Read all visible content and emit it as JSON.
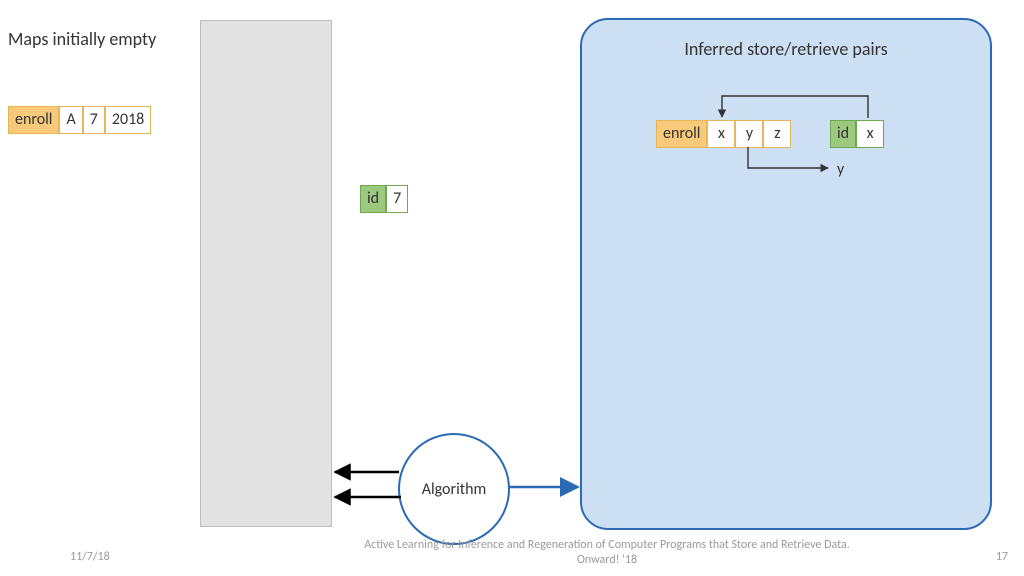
{
  "header": {
    "maps_empty": "Maps initially empty"
  },
  "enroll_example": {
    "label": "enroll",
    "a": "A",
    "b": "7",
    "c": "2018"
  },
  "id_example": {
    "label": "id",
    "value": "7"
  },
  "algorithm": {
    "label": "Algorithm"
  },
  "panel": {
    "title": "Inferred store/retrieve pairs",
    "enroll": {
      "label": "enroll",
      "x": "x",
      "y": "y",
      "z": "z"
    },
    "id": {
      "label": "id",
      "x": "x"
    },
    "output": "y"
  },
  "footer": {
    "date": "11/7/18",
    "title": "Active Learning for Inference and Regeneration of Computer Programs that Store and Retrieve Data. Onward! '18",
    "page": "17"
  }
}
